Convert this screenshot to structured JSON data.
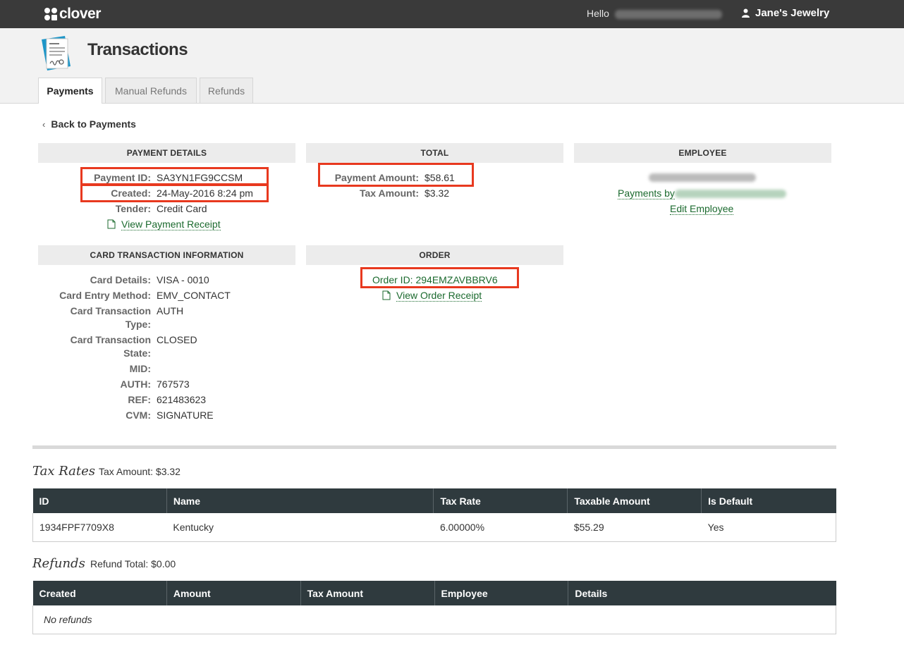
{
  "topbar": {
    "logo_text": "clover",
    "hello": "Hello",
    "merchant": "Jane's Jewelry"
  },
  "header": {
    "title": "Transactions",
    "tabs": [
      {
        "label": "Payments",
        "active": true
      },
      {
        "label": "Manual Refunds",
        "active": false
      },
      {
        "label": "Refunds",
        "active": false
      }
    ]
  },
  "back_link": "Back to Payments",
  "payment_details": {
    "heading": "PAYMENT DETAILS",
    "payment_id_label": "Payment ID:",
    "payment_id": "SA3YN1FG9CCSM",
    "created_label": "Created:",
    "created": "24-May-2016 8:24 pm",
    "tender_label": "Tender:",
    "tender": "Credit Card",
    "receipt_link": "View Payment Receipt"
  },
  "total": {
    "heading": "TOTAL",
    "payment_amount_label": "Payment Amount:",
    "payment_amount": "$58.61",
    "tax_amount_label": "Tax Amount:",
    "tax_amount": "$3.32"
  },
  "employee": {
    "heading": "EMPLOYEE",
    "payments_by": "Payments by",
    "edit_link": "Edit Employee"
  },
  "card_info": {
    "heading": "CARD TRANSACTION INFORMATION",
    "rows": [
      {
        "label": "Card Details:",
        "value": "VISA - 0010"
      },
      {
        "label": "Card Entry Method:",
        "value": "EMV_CONTACT"
      },
      {
        "label": "Card Transaction",
        "label2": "Type:",
        "value": "AUTH"
      },
      {
        "label": "Card Transaction",
        "label2": "State:",
        "value": "CLOSED"
      },
      {
        "label": "MID:",
        "value": ""
      },
      {
        "label": "AUTH:",
        "value": "767573"
      },
      {
        "label": "REF:",
        "value": "621483623"
      },
      {
        "label": "CVM:",
        "value": "SIGNATURE"
      }
    ]
  },
  "order": {
    "heading": "ORDER",
    "order_id": "Order ID: 294EMZAVBBRV6",
    "receipt_link": "View Order Receipt"
  },
  "tax_rates": {
    "title": "Tax Rates",
    "subtitle": "Tax Amount: $3.32",
    "columns": [
      "ID",
      "Name",
      "Tax Rate",
      "Taxable Amount",
      "Is Default"
    ],
    "rows": [
      [
        "1934FPF7709X8",
        "Kentucky",
        "6.00000%",
        "$55.29",
        "Yes"
      ]
    ]
  },
  "refunds": {
    "title": "Refunds",
    "subtitle": "Refund Total: $0.00",
    "columns": [
      "Created",
      "Amount",
      "Tax Amount",
      "Employee",
      "Details"
    ],
    "empty": "No refunds"
  },
  "colors": {
    "topbar": "#3a3a3a",
    "table_header": "#2f3a3e",
    "link": "#1b6a2e",
    "highlight": "#e8391f"
  }
}
